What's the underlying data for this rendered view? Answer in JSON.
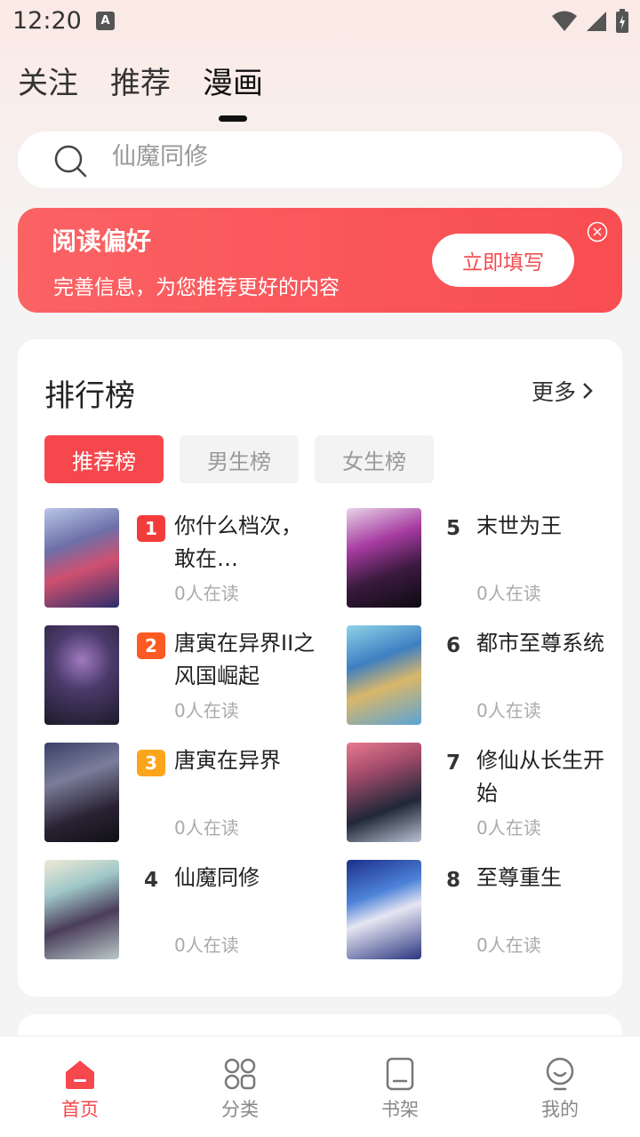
{
  "status_bar": {
    "time": "12:20",
    "notification_icon": "a-icon"
  },
  "top_tabs": [
    {
      "label": "关注",
      "active": false
    },
    {
      "label": "推荐",
      "active": false
    },
    {
      "label": "漫画",
      "active": true
    }
  ],
  "search": {
    "placeholder": "仙魔同修",
    "icon": "search-icon"
  },
  "banner": {
    "title": "阅读偏好",
    "subtitle": "完善信息，为您推荐更好的内容",
    "button": "立即填写",
    "close_icon": "close-icon"
  },
  "ranking": {
    "title": "排行榜",
    "more": "更多",
    "filters": [
      {
        "label": "推荐榜",
        "active": true
      },
      {
        "label": "男生榜",
        "active": false
      },
      {
        "label": "女生榜",
        "active": false
      }
    ],
    "items": [
      {
        "rank": "1",
        "title": "你什么档次，敢在…",
        "readers": "0人在读"
      },
      {
        "rank": "2",
        "title": "唐寅在异界II之风国崛起",
        "readers": "0人在读"
      },
      {
        "rank": "3",
        "title": "唐寅在异界",
        "readers": "0人在读"
      },
      {
        "rank": "4",
        "title": "仙魔同修",
        "readers": "0人在读"
      },
      {
        "rank": "5",
        "title": "末世为王",
        "readers": "0人在读"
      },
      {
        "rank": "6",
        "title": "都市至尊系统",
        "readers": "0人在读"
      },
      {
        "rank": "7",
        "title": "修仙从长生开始",
        "readers": "0人在读"
      },
      {
        "rank": "8",
        "title": "至尊重生",
        "readers": "0人在读"
      }
    ]
  },
  "bottom_nav": [
    {
      "label": "首页",
      "icon": "home-icon",
      "active": true
    },
    {
      "label": "分类",
      "icon": "category-icon",
      "active": false
    },
    {
      "label": "书架",
      "icon": "bookshelf-icon",
      "active": false
    },
    {
      "label": "我的",
      "icon": "profile-icon",
      "active": false
    }
  ],
  "colors": {
    "accent": "#f5474c",
    "rank1": "#f23c3c",
    "rank2": "#fb5a22",
    "rank3": "#fba51d"
  }
}
